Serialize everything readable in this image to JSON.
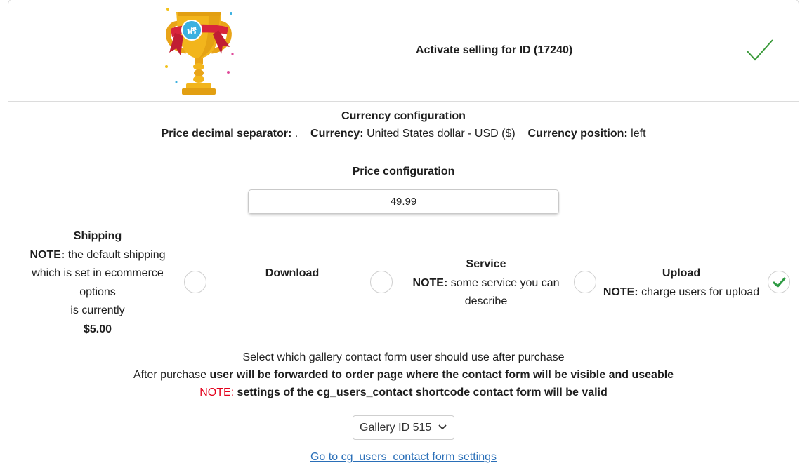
{
  "header": {
    "title": "Activate selling for ID (17240)",
    "trophy_text": "ฟรี",
    "colors": {
      "check": "#3a9a3a",
      "gold": "#f2b51c",
      "ribbon": "#d8243c"
    }
  },
  "currency": {
    "heading": "Currency configuration",
    "decimal_label": "Price decimal separator:",
    "decimal_value": ".",
    "currency_label": "Currency:",
    "currency_value": "United States dollar - USD ($)",
    "position_label": "Currency position:",
    "position_value": "left"
  },
  "price": {
    "heading": "Price configuration",
    "value": "49.99"
  },
  "options": {
    "shipping": {
      "title": "Shipping",
      "note_label": "NOTE:",
      "note_line1": "the default shipping",
      "note_line2": "which is set in ecommerce",
      "note_line3": "options",
      "note_line4": "is currently",
      "amount": "$5.00",
      "checked": false
    },
    "download": {
      "title": "Download",
      "checked": false
    },
    "service": {
      "title": "Service",
      "note_label": "NOTE:",
      "note_line1": "some service you can",
      "note_line2": "describe",
      "checked": false
    },
    "upload": {
      "title": "Upload",
      "note_label": "NOTE:",
      "note_text": "charge users for upload",
      "checked": true
    }
  },
  "contact": {
    "line1": "Select which gallery contact form user should use after purchase",
    "line2_a": "After purchase",
    "line2_b": "user will be forwarded to order page where the contact form will be visible and useable",
    "note_label": "NOTE:",
    "note_text": "settings of the cg_users_contact shortcode contact form will be valid",
    "select_value": "Gallery ID 515",
    "link_text": "Go to cg_users_contact form settings"
  }
}
